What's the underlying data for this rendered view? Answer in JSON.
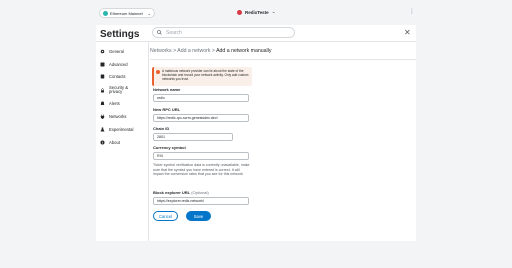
{
  "topbar": {
    "network_label": "Ethereum Mainnet",
    "account_name": "RedixTeste",
    "colors": {
      "network_dot": "#29b6af",
      "account_avatar": "#d73847"
    }
  },
  "header": {
    "title": "Settings",
    "search_placeholder": "Search"
  },
  "sidebar": {
    "items": [
      {
        "label": "General",
        "icon": "gear-icon"
      },
      {
        "label": "Advanced",
        "icon": "sliders-icon"
      },
      {
        "label": "Contacts",
        "icon": "book-icon"
      },
      {
        "label": "Security & privacy",
        "icon": "lock-icon"
      },
      {
        "label": "Alerts",
        "icon": "bell-icon"
      },
      {
        "label": "Networks",
        "icon": "plug-icon"
      },
      {
        "label": "Experimental",
        "icon": "flask-icon"
      },
      {
        "label": "About",
        "icon": "info-icon"
      }
    ]
  },
  "breadcrumb": {
    "part1": "Networks",
    "part2": "Add a network",
    "current": "Add a network manually",
    "sep": ">"
  },
  "warning": {
    "text": "A malicious network provider can lie about the state of the blockchain and record your network activity. Only add custom networks you trust."
  },
  "form": {
    "network_name_label": "Network name",
    "network_name_value": "redix",
    "rpc_label": "New RPC URL",
    "rpc_value": "https://redix-rpc-scrm.genesisdex.dev/",
    "chain_id_label": "Chain ID",
    "chain_id_value": "2801",
    "symbol_label": "Currency symbol",
    "symbol_value": "RXI",
    "symbol_note": "Ticker symbol verification data is currently unavailable, make sure that the symbol you have entered is correct. It will impact the conversion rates that you see for this network",
    "explorer_label": "Block explorer URL",
    "explorer_optional": "(Optional)",
    "explorer_value": "https://explorer.redix.network/"
  },
  "actions": {
    "cancel_label": "Cancel",
    "save_label": "Save"
  }
}
